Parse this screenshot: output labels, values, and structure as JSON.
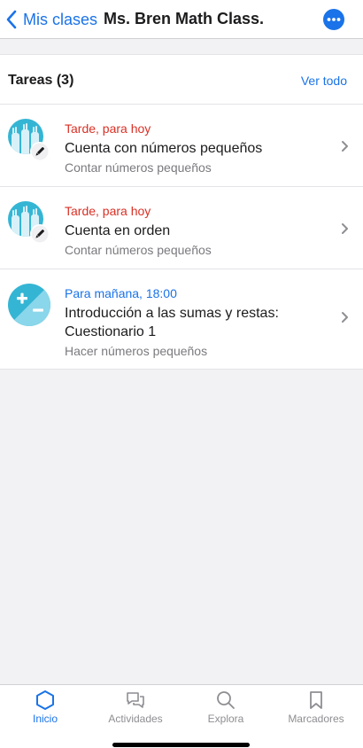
{
  "nav": {
    "back_label": "Mis clases",
    "title": "Ms. Bren Math Class.",
    "more_icon": "more-horizontal-icon"
  },
  "assignments": {
    "header": "Tareas (3)",
    "see_all": "Ver todo",
    "items": [
      {
        "status": "Tarde, para hoy",
        "status_color": "#d93025",
        "title": "Cuenta con números pequeños",
        "subtitle": "Contar números pequeños",
        "icon": "counting-hands-icon"
      },
      {
        "status": "Tarde, para hoy",
        "status_color": "#d93025",
        "title": "Cuenta en orden",
        "subtitle": "Contar números pequeños",
        "icon": "counting-hands-icon"
      },
      {
        "status": "Para mañana, 18:00",
        "status_color": "#1a73e8",
        "title": "Introducción a las sumas y restas: Cuestionario 1",
        "subtitle": "Hacer números pequeños",
        "icon": "plus-minus-icon"
      }
    ]
  },
  "tabs": [
    {
      "label": "Inicio",
      "icon": "home-hexagon-icon",
      "active": true
    },
    {
      "label": "Actividades",
      "icon": "chat-bubbles-icon",
      "active": false
    },
    {
      "label": "Explora",
      "icon": "search-icon",
      "active": false
    },
    {
      "label": "Marcadores",
      "icon": "bookmark-icon",
      "active": false
    }
  ],
  "colors": {
    "accent": "#1a73e8",
    "late": "#d93025",
    "avatar_teal": "#35b5d4"
  }
}
